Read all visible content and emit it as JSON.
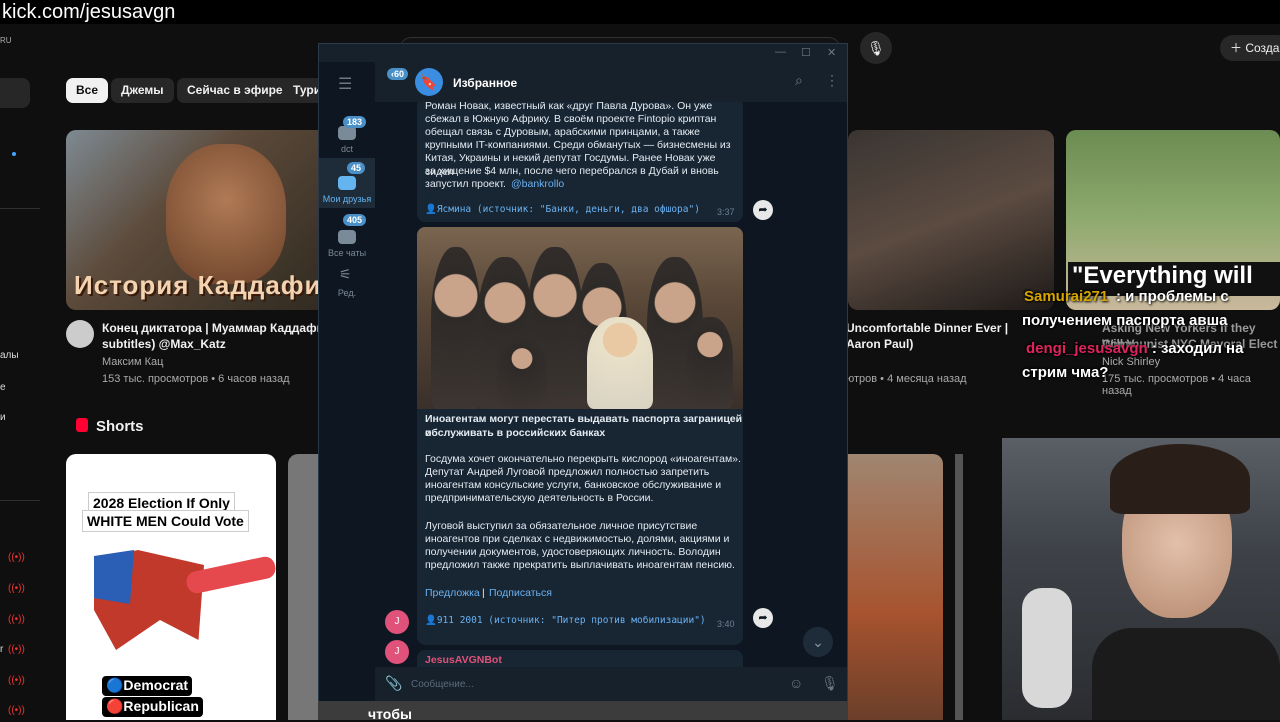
{
  "kick": {
    "url": "kick.com/jesusavgn"
  },
  "youtube": {
    "region": "RU",
    "create_label": "Созда",
    "chips": [
      "Все",
      "Джемы",
      "Сейчас в эфире",
      "Туриз"
    ],
    "sidebar_fragments": [
      "алы",
      "е",
      "и",
      "r"
    ],
    "videos": [
      {
        "thumb_text": "История Каддафи",
        "title_line1": "Конец диктатора | Муаммар Каддафи",
        "title_line2": "subtitles) @Max_Katz",
        "channel": "Максим Кац",
        "stats": "153 тыс. просмотров • 6 часов назад"
      },
      {
        "title_line1": "Uncomfortable Dinner Ever |",
        "title_line2": "Aaron Paul)",
        "stats": "ютров • 4 месяца назад"
      },
      {
        "thumb_text": "\"Everything will",
        "title_line1": "Asking New Yorkers If they Will V",
        "title_line2": "Communist NYC Mayoral Elect",
        "channel": "Nick Shirley",
        "stats": "175 тыс. просмотров • 4 часа назад"
      }
    ],
    "shorts": {
      "label": "Shorts",
      "short1_line1": "2028 Election If Only",
      "short1_line2": "WHITE MEN Could Vote",
      "legend_democrat": "🔵Democrat",
      "legend_republican": "🔴Republican",
      "bottom_text": "чтобы"
    }
  },
  "stream_chat": [
    {
      "user": "Samurai271",
      "text": ": и проблемы с получением паспорта авша"
    },
    {
      "user": "dengi_jesusavgn",
      "text": ": заходил на стрим чма?"
    }
  ],
  "telegram": {
    "chat_title": "Избранное",
    "back_count": "60",
    "folders": [
      {
        "label": "dct",
        "badge": "183"
      },
      {
        "label": "Мои друзья",
        "badge": "45"
      },
      {
        "label": "Все чаты",
        "badge": "405"
      },
      {
        "label": "Ред.",
        "badge": ""
      }
    ],
    "message1": {
      "text_lines": [
        "Роман Новак, известный как «друг Павла Дурова». Он уже",
        "сбежал в Южную Африку. В своём проекте Fintopio криптан",
        "обещал связь с Дуровым, арабскими принцами, а также",
        "крупными IT-компаниями. Среди обманутых — бизнесмены из",
        "Китая, Украины и некий депутат Госдумы. Ранее Новак уже сидел",
        "за хищение $4 млн, после чего перебрался в Дубай и вновь",
        "запустил проект."
      ],
      "link": "@bankrollo",
      "forward": "👤Ясмина (источник: \"Банки, деньги, два офшора\")",
      "time": "3:37"
    },
    "message2": {
      "headline_1": "Иноагентам могут перестать выдавать паспорта заграницей и",
      "headline_2": "обслуживать в российских банках",
      "para1": [
        "Госдума хочет окончательно перекрыть кислород «иноагентам».",
        "Депутат Андрей Луговой предложил полностью запретить",
        "иноагентам консульские услуги, банковское обслуживание и",
        "предпринимательскую деятельность в России."
      ],
      "para2": [
        "Луговой выступил за обязательное личное присутствие",
        "иноагентов при сделках с недвижимостью, долями, акциями и",
        "получении документов, удостоверяющих личность. Володин",
        "предложил также прекратить выплачивать иноагентам пенсию."
      ],
      "link_suggest": "Предложка",
      "separator": "|",
      "link_subscribe": "Подписаться",
      "forward": "👤911 2001 (источник: \"Питер против мобилизации\")",
      "time": "3:40"
    },
    "message3": {
      "sender": "JesusAVGNBot"
    },
    "avatar_letter": "J",
    "input_placeholder": "Сообщение..."
  }
}
